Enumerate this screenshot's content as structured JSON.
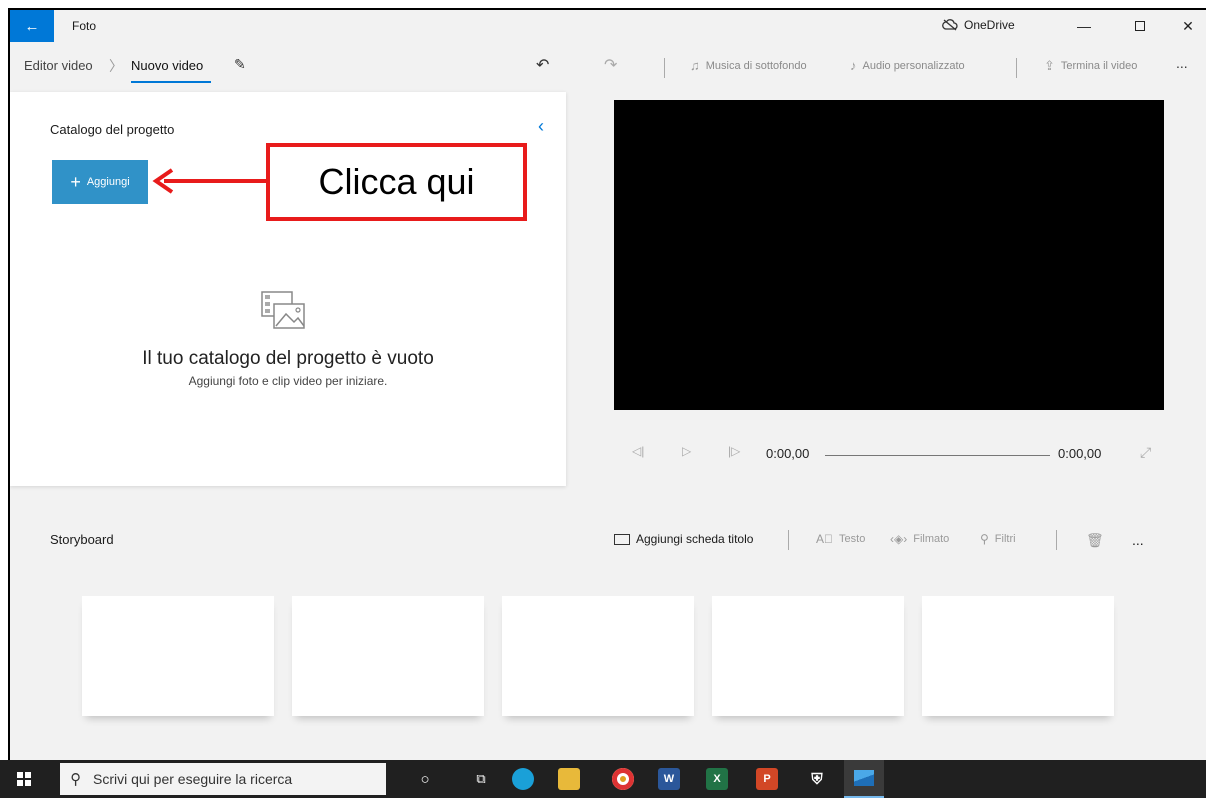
{
  "window": {
    "title": "Foto",
    "onedrive_label": "OneDrive"
  },
  "cmdbar": {
    "breadcrumb_root": "Editor video",
    "breadcrumb_current": "Nuovo video",
    "musica_label": "Musica di sottofondo",
    "audio_label": "Audio personalizzato",
    "termina_label": "Termina il video",
    "more": "..."
  },
  "catalog": {
    "title": "Catalogo del progetto",
    "add_label": "Aggiungi",
    "empty_title": "Il tuo catalogo del progetto è vuoto",
    "empty_subtitle": "Aggiungi foto e clip video per iniziare."
  },
  "annotation": {
    "text": "Clicca qui"
  },
  "player": {
    "current_time": "0:00,00",
    "total_time": "0:00,00"
  },
  "storyboard": {
    "title": "Storyboard",
    "add_title_card": "Aggiungi scheda titolo",
    "testo": "Testo",
    "filmato": "Filmato",
    "filtri": "Filtri",
    "more": "...",
    "slots": [
      "",
      "",
      "",
      "",
      ""
    ]
  },
  "taskbar": {
    "search_placeholder": "Scrivi qui per eseguire la ricerca"
  }
}
